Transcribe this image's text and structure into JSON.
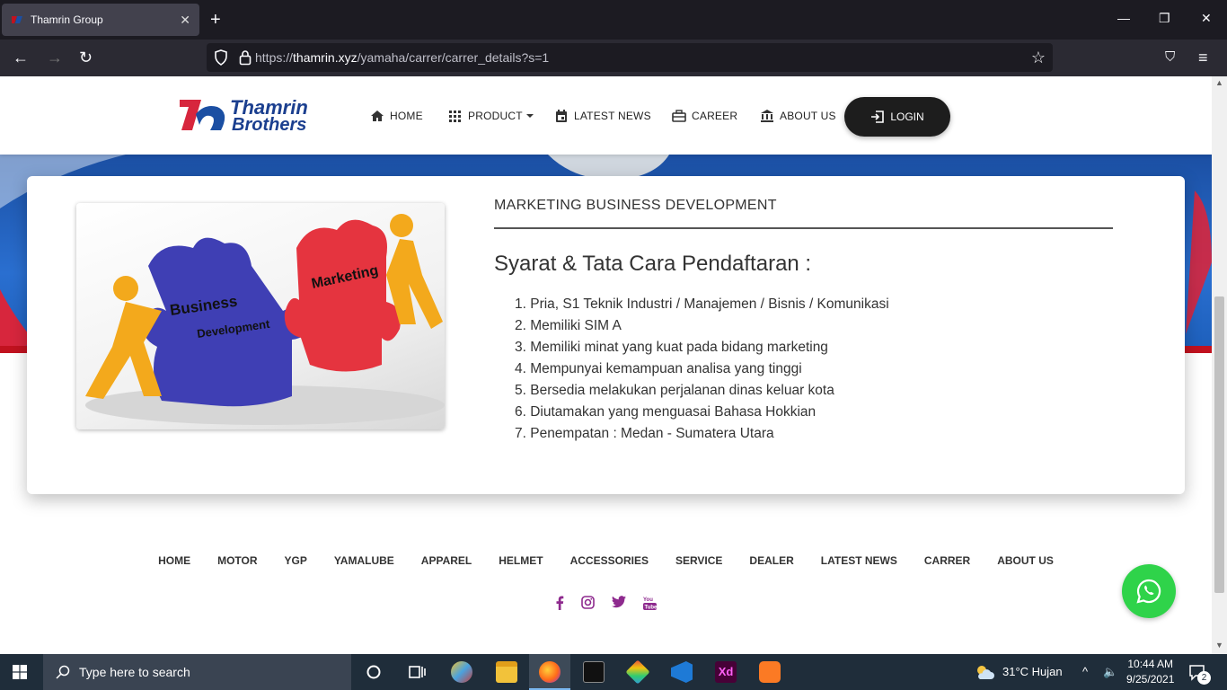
{
  "browser": {
    "tab_title": "Thamrin Group",
    "tab_close": "✕",
    "new_tab": "+",
    "url_prefix": "https://",
    "url_host": "thamrin.xyz",
    "url_path": "/yamaha/carrer/carrer_details?s=1"
  },
  "header": {
    "logo_line1": "Thamrin",
    "logo_line2": "Brothers",
    "menu": [
      {
        "label": "HOME",
        "icon": "home-icon"
      },
      {
        "label": "PRODUCT",
        "icon": "grid-icon"
      },
      {
        "label": "LATEST NEWS",
        "icon": "calendar-icon"
      },
      {
        "label": "CAREER",
        "icon": "briefcase-icon"
      },
      {
        "label": "ABOUT US",
        "icon": "bank-icon"
      }
    ],
    "login_label": "LOGIN"
  },
  "job": {
    "title": "MARKETING BUSINESS DEVELOPMENT",
    "requirements_heading": "Syarat & Tata Cara Pendaftaran :",
    "image_words": [
      "Business",
      "Development",
      "Marketing"
    ],
    "requirements": [
      "1. Pria, S1 Teknik Industri / Manajemen / Bisnis / Komunikasi",
      "2. Memiliki SIM A",
      "3. Memiliki minat yang kuat pada bidang marketing",
      "4. Mempunyai kemampuan analisa yang tinggi",
      "5. Bersedia melakukan perjalanan dinas keluar kota",
      "6. Diutamakan yang menguasai Bahasa Hokkian",
      "7. Penempatan : Medan - Sumatera Utara"
    ]
  },
  "footer": {
    "links": [
      "HOME",
      "MOTOR",
      "YGP",
      "YAMALUBE",
      "APPAREL",
      "HELMET",
      "ACCESSORIES",
      "SERVICE",
      "DEALER",
      "LATEST NEWS",
      "CARRER",
      "ABOUT US"
    ],
    "social": [
      "facebook-icon",
      "instagram-icon",
      "twitter-icon",
      "youtube-icon"
    ],
    "social_color": "#8e2a8e",
    "whatsapp_color": "#2fd34a"
  },
  "taskbar": {
    "search_placeholder": "Type here to search",
    "weather": "31°C  Hujan",
    "time": "10:44 AM",
    "date": "9/25/2021",
    "notification_count": "2"
  }
}
